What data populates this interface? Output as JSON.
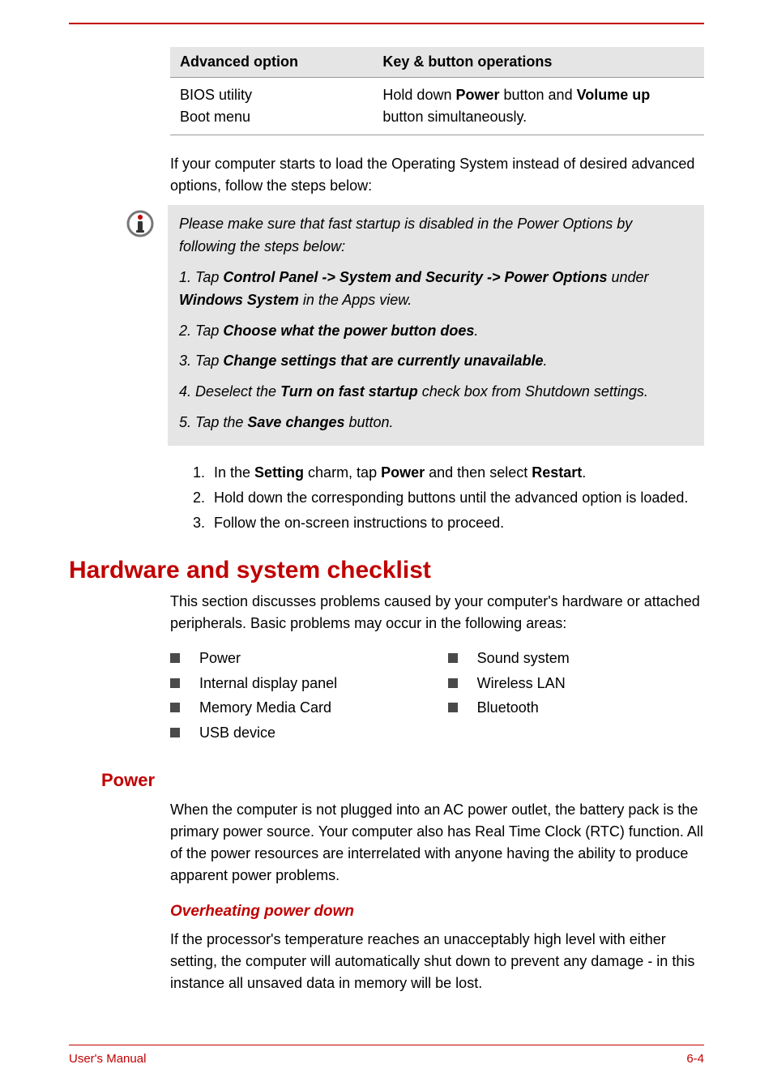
{
  "table": {
    "header_col1": "Advanced option",
    "header_col2": "Key & button operations",
    "row1_col1_line1": "BIOS utility",
    "row1_col1_line2": "Boot menu",
    "row1_col2_pre": "Hold down ",
    "row1_col2_b1": "Power",
    "row1_col2_mid": " button and ",
    "row1_col2_b2": "Volume up",
    "row1_col2_post": " button simultaneously."
  },
  "para_intro": "If your computer starts to load the Operating System instead of desired advanced options, follow the steps below:",
  "note": {
    "p1": "Please make sure that fast startup is disabled in the Power Options by following the steps below:",
    "p2_pre": "1. Tap ",
    "p2_b1": "Control Panel -> System and Security -> Power Options",
    "p2_mid": " under ",
    "p2_b2": "Windows System",
    "p2_post": " in the Apps view.",
    "p3_pre": "2. Tap ",
    "p3_b": "Choose what the power button does",
    "p3_post": ".",
    "p4_pre": "3. Tap ",
    "p4_b": "Change settings that are currently unavailable",
    "p4_post": ".",
    "p5_pre": "4. Deselect the ",
    "p5_b": "Turn on fast startup",
    "p5_post": " check box from Shutdown settings.",
    "p6_pre": "5. Tap the ",
    "p6_b": "Save changes",
    "p6_post": " button."
  },
  "steps": {
    "s1_pre": "In the ",
    "s1_b1": "Setting",
    "s1_mid1": " charm, tap ",
    "s1_b2": "Power",
    "s1_mid2": " and then select ",
    "s1_b3": "Restart",
    "s1_post": ".",
    "s2": "Hold down the corresponding buttons until the advanced option is loaded.",
    "s3": "Follow the on-screen instructions to proceed."
  },
  "h1": "Hardware and system checklist",
  "checklist_intro": "This section discusses problems caused by your computer's hardware or attached peripherals. Basic problems may occur in the following areas:",
  "checklist": {
    "left": [
      "Power",
      "Internal display panel",
      "Memory Media Card",
      "USB device"
    ],
    "right": [
      "Sound system",
      "Wireless LAN",
      "Bluetooth"
    ]
  },
  "h2_power": "Power",
  "power_para": "When the computer is not plugged into an AC power outlet, the battery pack is the primary power source. Your computer also has Real Time Clock (RTC) function. All of the power resources are interrelated with anyone having the ability to produce apparent power problems.",
  "h3_overheat": "Overheating power down",
  "overheat_para": "If the processor's temperature reaches an unacceptably high level with either setting, the computer will automatically shut down to prevent any damage - in this instance all unsaved data in memory will be lost.",
  "footer": {
    "left": "User's Manual",
    "right": "6-4"
  }
}
